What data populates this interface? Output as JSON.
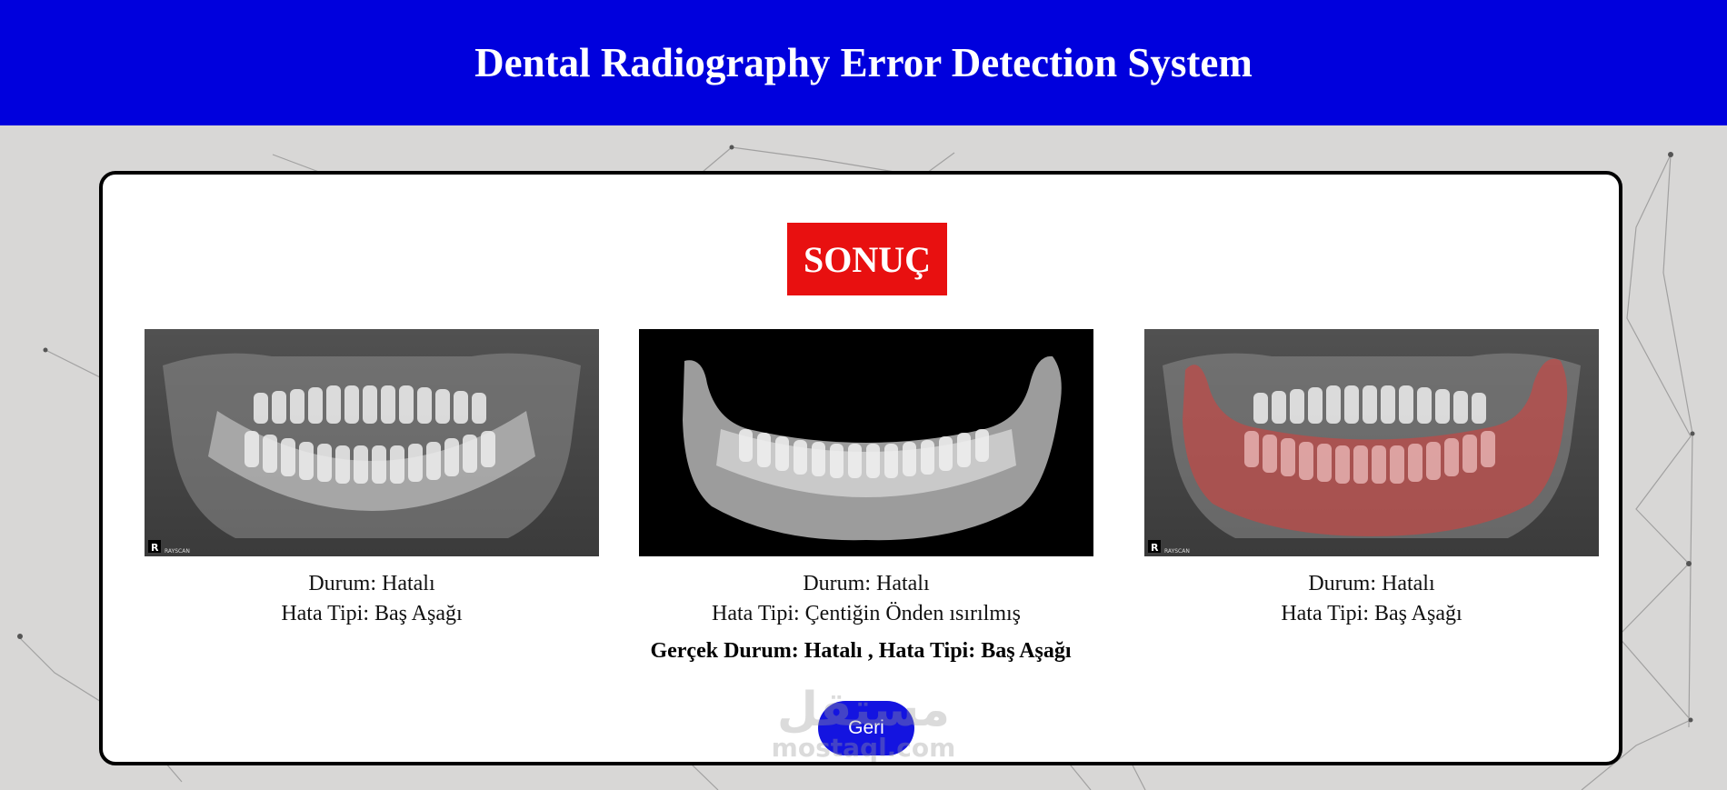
{
  "header": {
    "title": "Dental Radiography Error Detection System"
  },
  "result": {
    "badge": "SONUÇ"
  },
  "panels": [
    {
      "image": "panoramic-xray-original",
      "status": "Durum: Hatalı",
      "error_type": "Hata Tipi: Baş Aşağı"
    },
    {
      "image": "panoramic-xray-segmented-jaw",
      "status": "Durum: Hatalı",
      "error_type": "Hata Tipi: Çentiğin Önden ısırılmış"
    },
    {
      "image": "panoramic-xray-red-overlay",
      "status": "Durum: Hatalı",
      "error_type": "Hata Tipi: Baş Aşağı"
    }
  ],
  "ground_truth": "Gerçek Durum: Hatalı , Hata Tipi: Baş Aşağı",
  "buttons": {
    "back": "Geri"
  },
  "watermark": {
    "arabic": "مستقل",
    "latin": "mostaql.com"
  },
  "xray_labels": {
    "r_marker": "R",
    "brand": "RAYSCAN"
  },
  "colors": {
    "header": "#0000dd",
    "badge": "#e81010",
    "button": "#1414e0",
    "overlay": "#e53935"
  }
}
